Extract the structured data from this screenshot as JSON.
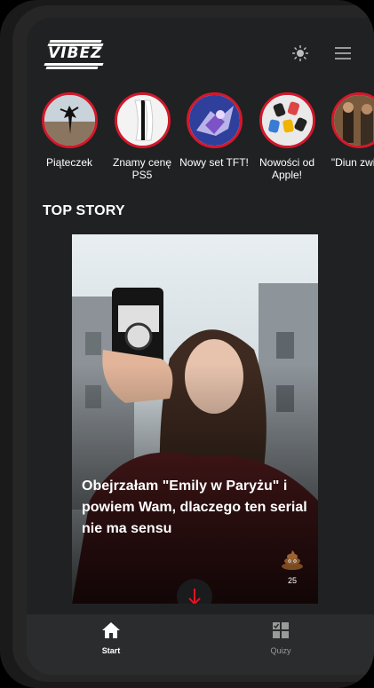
{
  "app": {
    "brand": "VIBEZ"
  },
  "header": {
    "theme_icon": "sun-icon",
    "menu_icon": "hamburger-menu-icon"
  },
  "stories": [
    {
      "label": "Piąteczek"
    },
    {
      "label": "Znamy cenę PS5"
    },
    {
      "label": "Nowy set TFT!"
    },
    {
      "label": "Nowości od Apple!"
    },
    {
      "label": "\"Diun zwias"
    }
  ],
  "top_story": {
    "section_label": "TOP STORY",
    "title": "Obejrzałam \"Emily w Paryżu\" i powiem Wam, dlaczego ten serial nie ma sensu",
    "reaction_icon": "poop-icon",
    "reaction_count": "25"
  },
  "tabbar": {
    "items": [
      {
        "label": "Start",
        "icon": "home-icon",
        "active": true
      },
      {
        "label": "Quizy",
        "icon": "quiz-grid-icon",
        "active": false
      }
    ]
  },
  "colors": {
    "accent": "#d3182b",
    "screen_bg": "#202122",
    "tabbar_bg": "#2b2c2d"
  }
}
